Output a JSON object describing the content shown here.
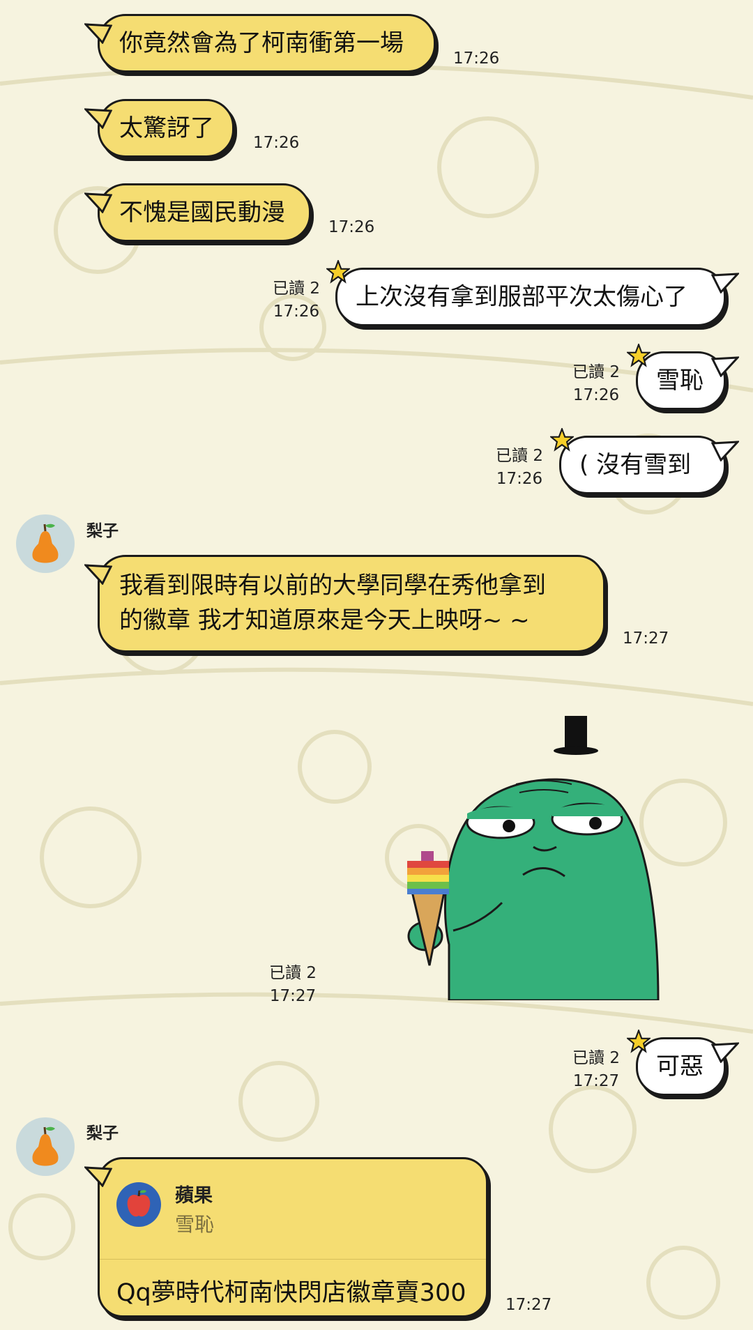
{
  "chat": {
    "messages": [
      {
        "side": "in",
        "text": "你竟然會為了柯南衝第一場",
        "time": "17:26"
      },
      {
        "side": "in",
        "text": "太驚訝了",
        "time": "17:26"
      },
      {
        "side": "in",
        "text": "不愧是國民動漫",
        "time": "17:26"
      },
      {
        "side": "out",
        "text": "上次沒有拿到服部平次太傷心了",
        "read": "已讀 2",
        "time": "17:26"
      },
      {
        "side": "out",
        "text": "雪恥",
        "read": "已讀 2",
        "time": "17:26"
      },
      {
        "side": "out",
        "text": "( 沒有雪到",
        "read": "已讀 2",
        "time": "17:26"
      },
      {
        "side": "in",
        "sender": "梨子",
        "line1": "我看到限時有以前的大學同學在秀他拿到",
        "line2": "的徽章 我才知道原來是今天上映呀~ ~",
        "time": "17:27"
      },
      {
        "side": "out",
        "type": "sticker",
        "sticker_icon": "green-monster-ice-cream-sticker",
        "read": "已讀 2",
        "time": "17:27"
      },
      {
        "side": "out",
        "text": "可惡",
        "read": "已讀 2",
        "time": "17:27"
      },
      {
        "side": "in",
        "sender": "梨子",
        "type": "reply",
        "reply_to_name": "蘋果",
        "reply_to_text": "雪恥",
        "text": "Qq夢時代柯南快閃店徽章賣300",
        "time": "17:27"
      }
    ]
  },
  "colors": {
    "incoming_bubble": "#f5dd72",
    "outgoing_bubble": "#ffffff",
    "background": "#f6f3df",
    "star": "#f6cf2a"
  }
}
